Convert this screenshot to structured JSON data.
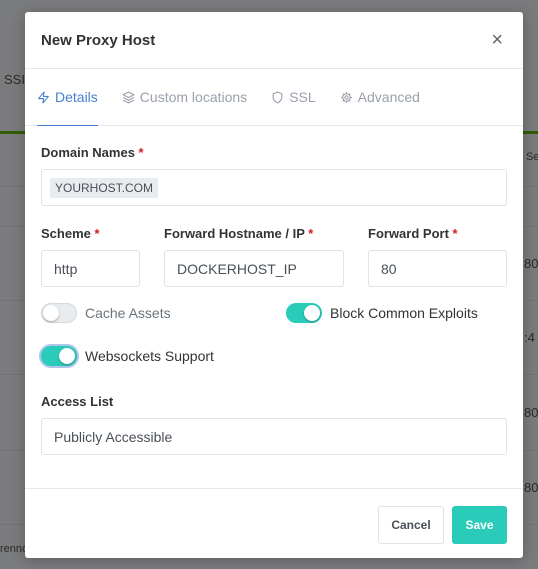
{
  "modal": {
    "title": "New Proxy Host",
    "close_symbol": "×"
  },
  "tabs": [
    {
      "label": "Details",
      "icon": "lightning-icon",
      "active": true
    },
    {
      "label": "Custom locations",
      "icon": "layers-icon",
      "active": false
    },
    {
      "label": "SSL",
      "icon": "shield-icon",
      "active": false
    },
    {
      "label": "Advanced",
      "icon": "gear-icon",
      "active": false
    }
  ],
  "form": {
    "domain_names": {
      "label": "Domain Names",
      "required_mark": "*",
      "chips": [
        "YOURHOST.COM"
      ]
    },
    "scheme": {
      "label": "Scheme",
      "required_mark": "*",
      "value": "http"
    },
    "forward_hostname": {
      "label": "Forward Hostname / IP",
      "required_mark": "*",
      "value": "DOCKERHOST_IP"
    },
    "forward_port": {
      "label": "Forward Port",
      "required_mark": "*",
      "value": "80"
    },
    "cache_assets": {
      "label": "Cache Assets",
      "enabled": false
    },
    "block_exploits": {
      "label": "Block Common Exploits",
      "enabled": true
    },
    "websockets": {
      "label": "Websockets Support",
      "enabled": true
    },
    "access_list": {
      "label": "Access List",
      "value": "Publicly Accessible"
    }
  },
  "footer": {
    "cancel_label": "Cancel",
    "save_label": "Save"
  },
  "background": {
    "left_texts": [
      "SSI",
      "renno"
    ],
    "right_texts": [
      "Se",
      "80",
      ":4",
      "80",
      "80"
    ]
  },
  "colors": {
    "accent_blue": "#467fcf",
    "toggle_on": "#2bcbba",
    "save_button": "#2bcbba",
    "required": "#cd201f"
  }
}
